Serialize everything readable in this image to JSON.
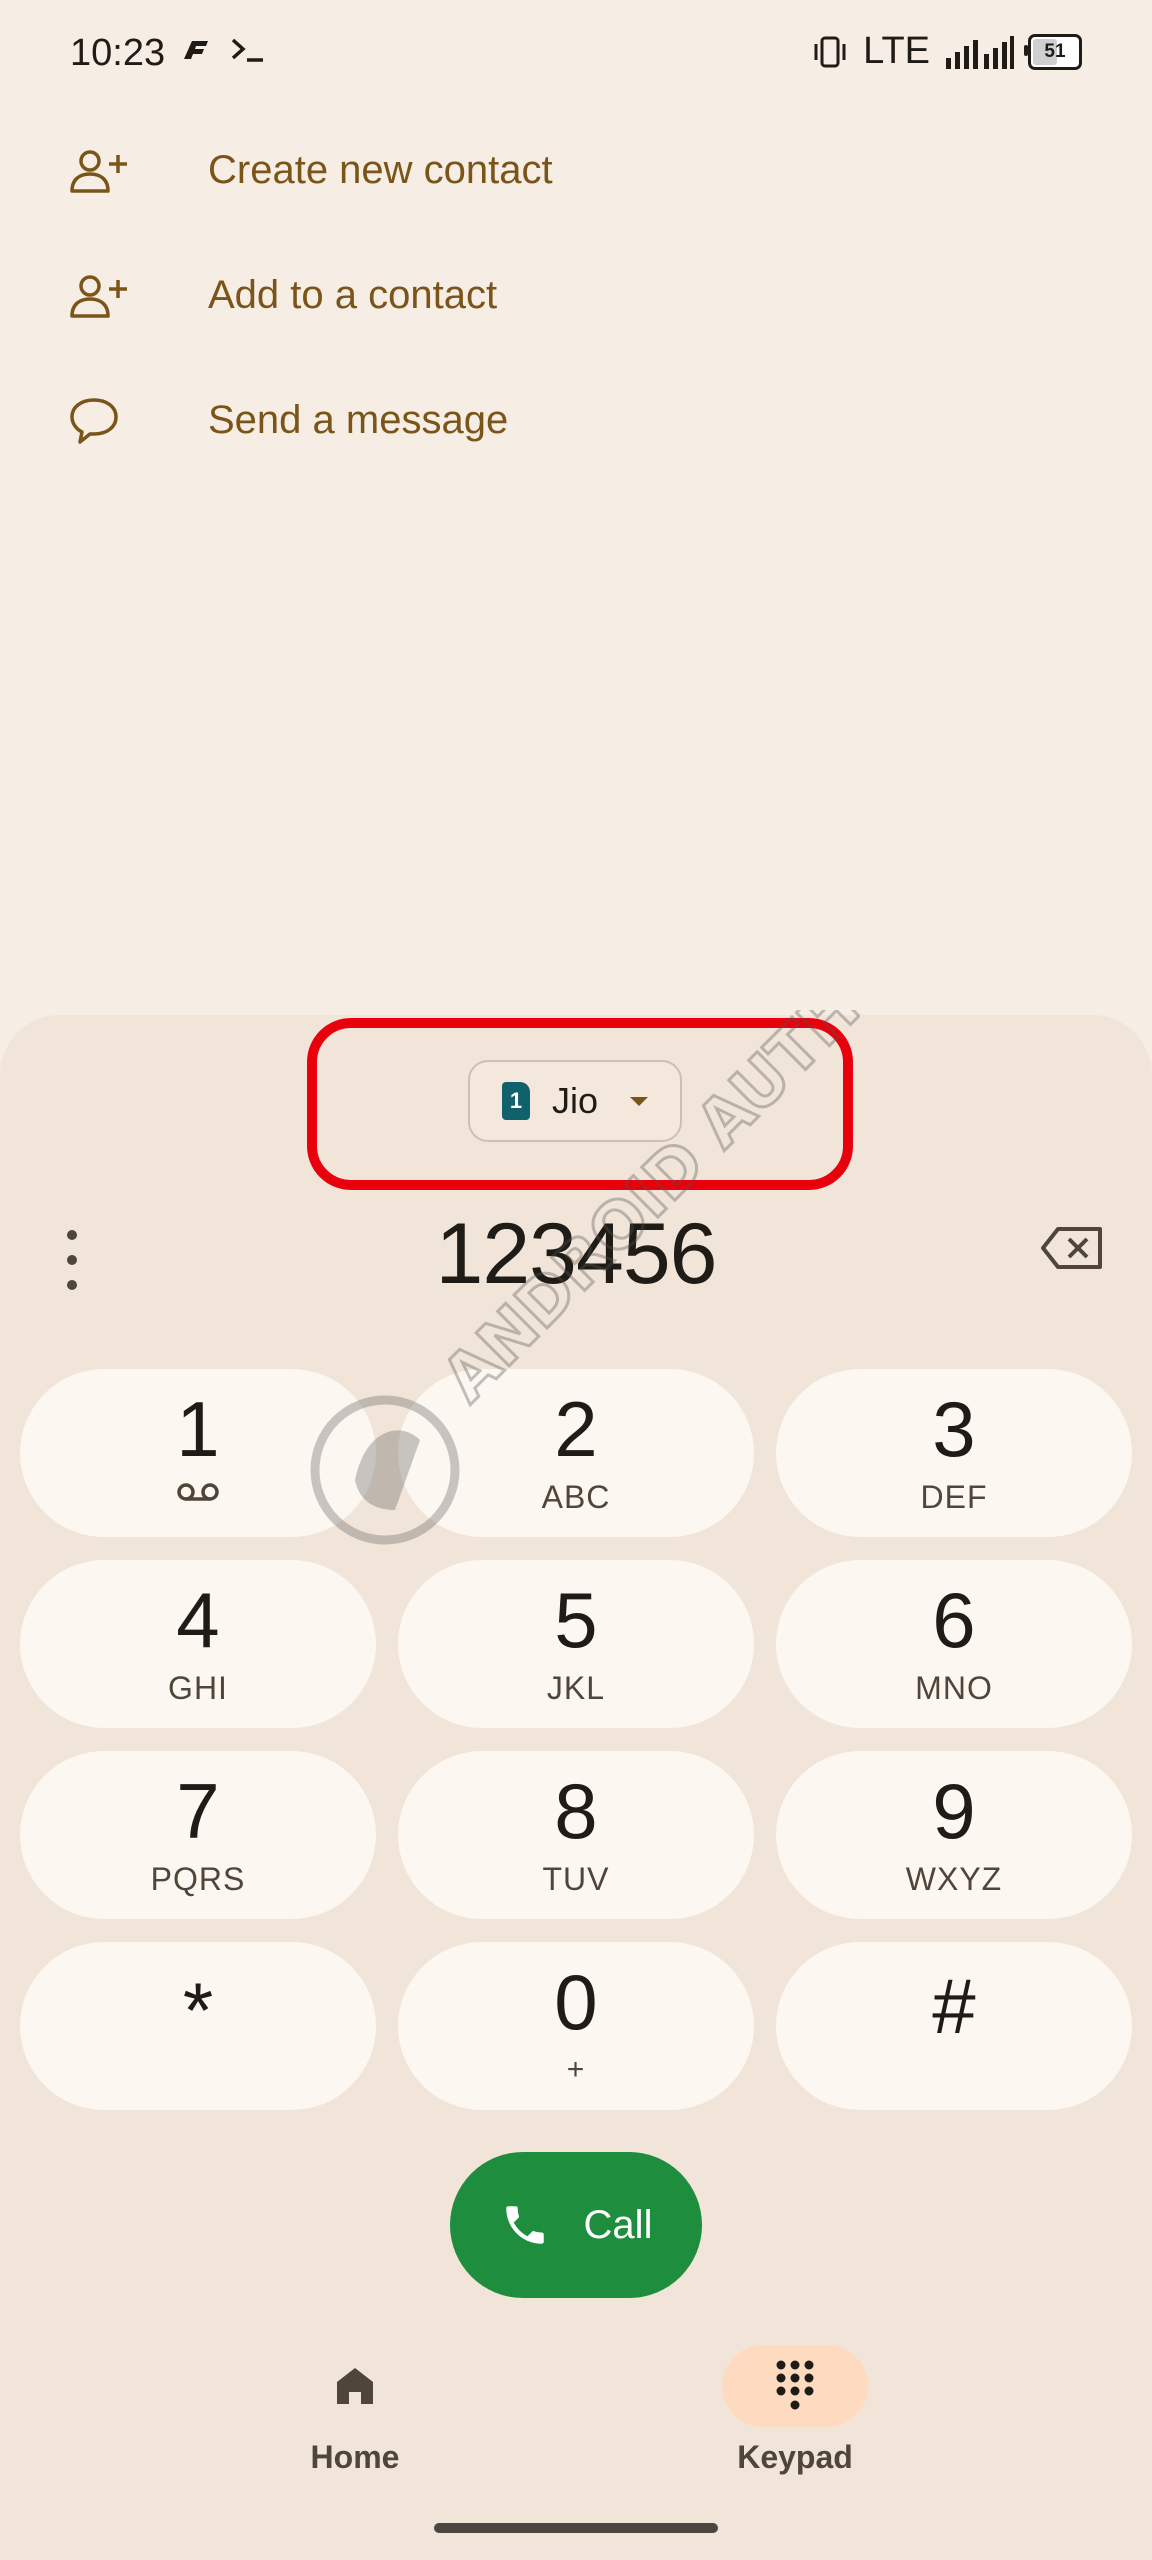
{
  "status_bar": {
    "time": "10:23",
    "network": "LTE",
    "battery": "51",
    "icons": [
      "fitness-app-icon",
      "terminal-icon",
      "vibrate-icon",
      "signal-icon",
      "battery-icon"
    ]
  },
  "actions": [
    {
      "label": "Create new contact",
      "icon": "person-add-icon"
    },
    {
      "label": "Add to a contact",
      "icon": "person-add-icon"
    },
    {
      "label": "Send a message",
      "icon": "message-icon"
    }
  ],
  "sim": {
    "slot": "1",
    "name": "Jio"
  },
  "dial": {
    "digits": "123456"
  },
  "keypad": [
    {
      "num": "1",
      "sub": "",
      "sub_icon": "voicemail-icon"
    },
    {
      "num": "2",
      "sub": "ABC"
    },
    {
      "num": "3",
      "sub": "DEF"
    },
    {
      "num": "4",
      "sub": "GHI"
    },
    {
      "num": "5",
      "sub": "JKL"
    },
    {
      "num": "6",
      "sub": "MNO"
    },
    {
      "num": "7",
      "sub": "PQRS"
    },
    {
      "num": "8",
      "sub": "TUV"
    },
    {
      "num": "9",
      "sub": "WXYZ"
    },
    {
      "num": "*",
      "sub": ""
    },
    {
      "num": "0",
      "sub": "+"
    },
    {
      "num": "#",
      "sub": ""
    }
  ],
  "call": {
    "label": "Call",
    "color": "#1e8e3e"
  },
  "nav": {
    "home": {
      "label": "Home",
      "icon": "home-icon"
    },
    "keypad": {
      "label": "Keypad",
      "icon": "dialpad-icon",
      "active": true
    }
  },
  "watermark": {
    "text": "ANDROID AUTHORITY"
  },
  "colors": {
    "accent": "#7a5418",
    "highlight": "#e8000d",
    "key_bg": "#fdf7f2",
    "panel_bg": "#f1e4d8"
  }
}
